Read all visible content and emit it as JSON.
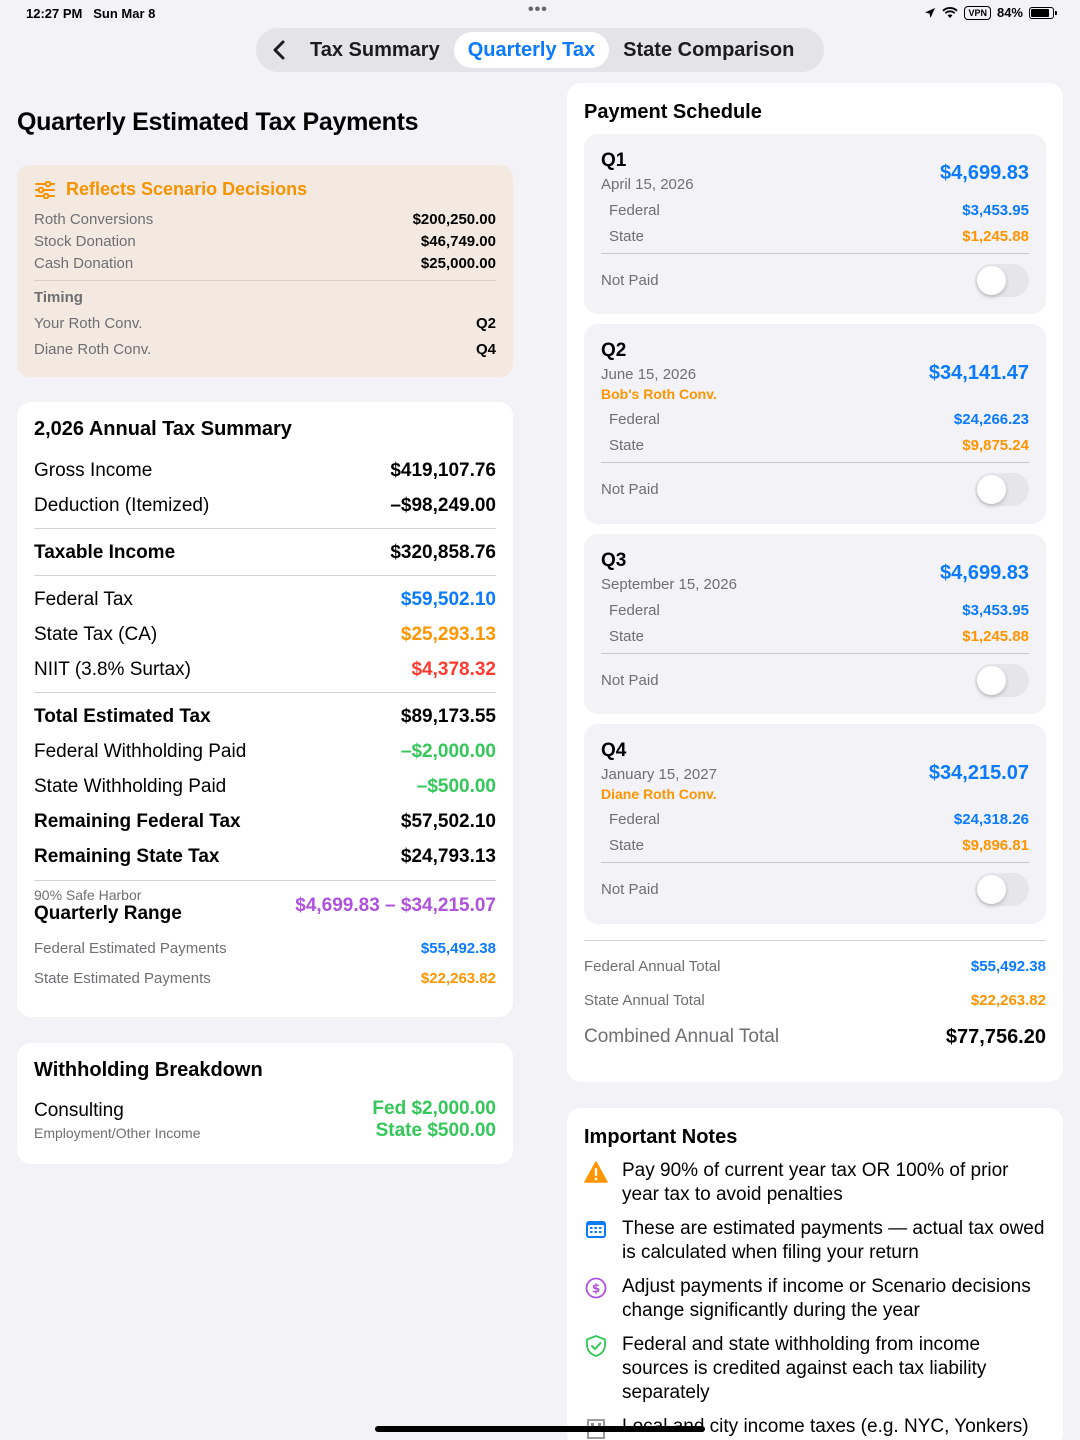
{
  "status_bar": {
    "time": "12:27 PM",
    "date": "Sun Mar 8",
    "vpn": "VPN",
    "battery": "84%"
  },
  "tabs": [
    {
      "label": "Tax Summary",
      "active": false
    },
    {
      "label": "Quarterly Tax",
      "active": true
    },
    {
      "label": "State Comparison",
      "active": false
    }
  ],
  "page_title": "Quarterly Estimated Tax Payments",
  "scenario": {
    "title": "Reflects Scenario Decisions",
    "items": [
      {
        "label": "Roth Conversions",
        "value": "$200,250.00"
      },
      {
        "label": "Stock Donation",
        "value": "$46,749.00"
      },
      {
        "label": "Cash Donation",
        "value": "$25,000.00"
      }
    ],
    "timing_label": "Timing",
    "timing": [
      {
        "label": "Your Roth Conv.",
        "value": "Q2"
      },
      {
        "label": "Diane Roth Conv.",
        "value": "Q4"
      }
    ]
  },
  "summary": {
    "title": "2,026 Annual Tax Summary",
    "gross_income": {
      "label": "Gross Income",
      "value": "$419,107.76"
    },
    "deduction": {
      "label": "Deduction (Itemized)",
      "value": "–$98,249.00"
    },
    "taxable_income": {
      "label": "Taxable Income",
      "value": "$320,858.76"
    },
    "federal_tax": {
      "label": "Federal Tax",
      "value": "$59,502.10"
    },
    "state_tax": {
      "label": "State Tax (CA)",
      "value": "$25,293.13"
    },
    "niit": {
      "label": "NIIT (3.8% Surtax)",
      "value": "$4,378.32"
    },
    "total_estimated": {
      "label": "Total Estimated Tax",
      "value": "$89,173.55"
    },
    "fed_withholding": {
      "label": "Federal Withholding Paid",
      "value": "–$2,000.00"
    },
    "state_withholding": {
      "label": "State Withholding Paid",
      "value": "–$500.00"
    },
    "remaining_fed": {
      "label": "Remaining Federal Tax",
      "value": "$57,502.10"
    },
    "remaining_state": {
      "label": "Remaining State Tax",
      "value": "$24,793.13"
    },
    "safe_harbor_small": "90% Safe Harbor",
    "safe_harbor_label": "Quarterly Range",
    "safe_harbor_value": "$4,699.83 – $34,215.07",
    "fed_est_payments": {
      "label": "Federal Estimated Payments",
      "value": "$55,492.38"
    },
    "state_est_payments": {
      "label": "State Estimated Payments",
      "value": "$22,263.82"
    }
  },
  "withholding": {
    "title": "Withholding Breakdown",
    "source": "Consulting",
    "source_sub": "Employment/Other Income",
    "fed": "Fed $2,000.00",
    "state": "State $500.00"
  },
  "schedule": {
    "title": "Payment Schedule",
    "federal_label": "Federal",
    "state_label": "State",
    "status_label": "Not Paid",
    "quarters": [
      {
        "q": "Q1",
        "date": "April 15, 2026",
        "note": "",
        "total": "$4,699.83",
        "federal": "$3,453.95",
        "state": "$1,245.88"
      },
      {
        "q": "Q2",
        "date": "June 15, 2026",
        "note": "Bob's Roth Conv.",
        "total": "$34,141.47",
        "federal": "$24,266.23",
        "state": "$9,875.24"
      },
      {
        "q": "Q3",
        "date": "September 15, 2026",
        "note": "",
        "total": "$4,699.83",
        "federal": "$3,453.95",
        "state": "$1,245.88"
      },
      {
        "q": "Q4",
        "date": "January 15, 2027",
        "note": "Diane Roth Conv.",
        "total": "$34,215.07",
        "federal": "$24,318.26",
        "state": "$9,896.81"
      }
    ],
    "federal_total": {
      "label": "Federal Annual Total",
      "value": "$55,492.38"
    },
    "state_total": {
      "label": "State Annual Total",
      "value": "$22,263.82"
    },
    "combined_total": {
      "label": "Combined Annual Total",
      "value": "$77,756.20"
    }
  },
  "notes": {
    "title": "Important Notes",
    "items": [
      {
        "icon": "warning-icon",
        "text": "Pay 90% of current year tax OR 100% of prior year tax to avoid penalties"
      },
      {
        "icon": "calendar-icon",
        "text": "These are estimated payments — actual tax owed is calculated when filing your return"
      },
      {
        "icon": "dollar-circle-icon",
        "text": "Adjust payments if income or Scenario decisions change significantly during the year"
      },
      {
        "icon": "shield-check-icon",
        "text": "Federal and state withholding from income sources is credited against each tax liability separately"
      },
      {
        "icon": "building-icon",
        "text": "Local and city income taxes (e.g. NYC, Yonkers)"
      }
    ]
  }
}
